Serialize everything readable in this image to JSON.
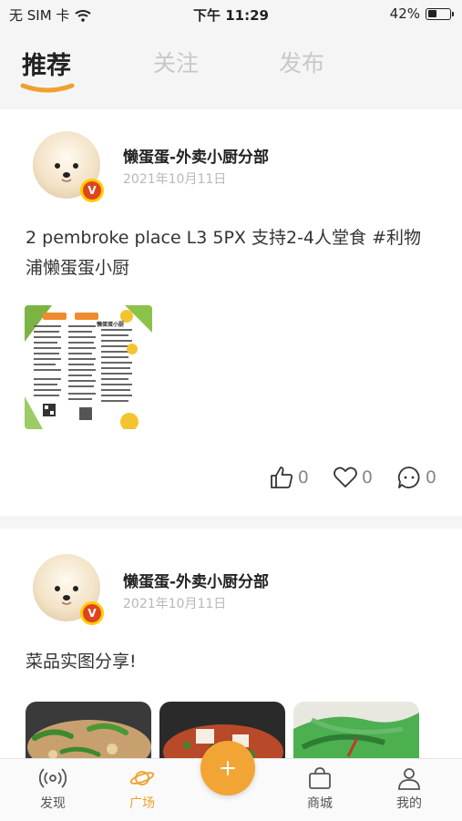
{
  "status_bar": {
    "carrier": "无 SIM 卡",
    "time": "下午 11:29",
    "battery": "42%",
    "battery_level": 0.42
  },
  "tabs": [
    {
      "label": "推荐",
      "active": true
    },
    {
      "label": "关注",
      "active": false
    },
    {
      "label": "发布",
      "active": false
    }
  ],
  "posts": [
    {
      "author": "懒蛋蛋-外卖小厨分部",
      "date": "2021年10月11日",
      "text": "2 pembroke place L3 5PX 支持2-4人堂食 #利物浦懒蛋蛋小厨",
      "image_caption": "懒蛋蛋小厨",
      "likes": "0",
      "favorites": "0",
      "comments": "0"
    },
    {
      "author": "懒蛋蛋-外卖小厨分部",
      "date": "2021年10月11日",
      "text": "菜品实图分享!"
    }
  ],
  "bottom_nav": [
    {
      "label": "发现",
      "icon": "broadcast-icon",
      "active": false
    },
    {
      "label": "广场",
      "icon": "planet-icon",
      "active": true
    },
    {
      "label": "商城",
      "icon": "shopping-bag-icon",
      "active": false
    },
    {
      "label": "我的",
      "icon": "person-icon",
      "active": false
    }
  ],
  "colors": {
    "accent": "#f0a030",
    "badge_red": "#e0441e"
  }
}
